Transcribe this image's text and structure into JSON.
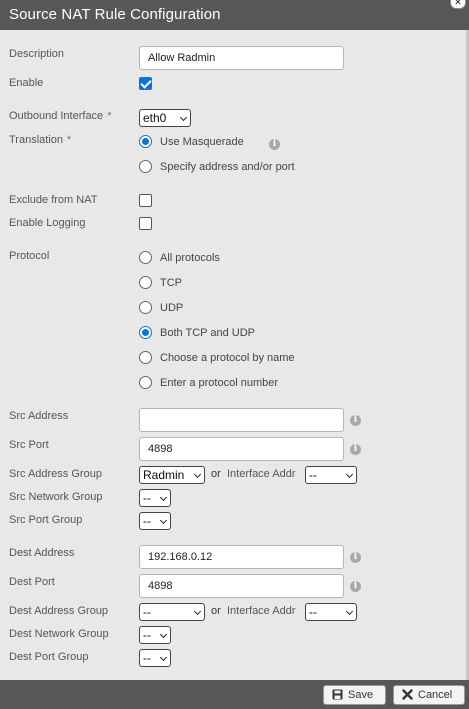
{
  "window": {
    "title": "Source NAT Rule Configuration",
    "close_icon": "close-icon"
  },
  "description": {
    "label": "Description",
    "value": "Allow Radmin"
  },
  "enable": {
    "label": "Enable",
    "checked": true
  },
  "outbound_interface": {
    "label": "Outbound Interface",
    "required_mark": "*",
    "value": "eth0"
  },
  "translation": {
    "label": "Translation",
    "required_mark": "*",
    "options": [
      "Use Masquerade",
      "Specify address and/or port"
    ],
    "selected": "Use Masquerade"
  },
  "exclude_from_nat": {
    "label": "Exclude from NAT",
    "checked": false
  },
  "enable_logging": {
    "label": "Enable Logging",
    "checked": false
  },
  "protocol": {
    "label": "Protocol",
    "options": [
      "All protocols",
      "TCP",
      "UDP",
      "Both TCP and UDP",
      "Choose a protocol by name",
      "Enter a protocol number"
    ],
    "selected": "Both TCP and UDP"
  },
  "src": {
    "address": {
      "label": "Src Address",
      "value": ""
    },
    "port": {
      "label": "Src Port",
      "value": "4898"
    },
    "address_group": {
      "label": "Src Address Group",
      "value": "Radmin",
      "or": "or",
      "interface_label": "Interface Addr",
      "interface_value": "--"
    },
    "network_group": {
      "label": "Src Network Group",
      "value": "--"
    },
    "port_group": {
      "label": "Src Port Group",
      "value": "--"
    }
  },
  "dest": {
    "address": {
      "label": "Dest Address",
      "value": "192.168.0.12"
    },
    "port": {
      "label": "Dest Port",
      "value": "4898"
    },
    "address_group": {
      "label": "Dest Address Group",
      "value": "--",
      "or": "or",
      "interface_label": "Interface Addr",
      "interface_value": "--"
    },
    "network_group": {
      "label": "Dest Network Group",
      "value": "--"
    },
    "port_group": {
      "label": "Dest Port Group",
      "value": "--"
    }
  },
  "footer": {
    "save_label": "Save",
    "cancel_label": "Cancel"
  },
  "info_glyph": "i",
  "colors": {
    "titlebar": "#575757",
    "accent": "#0a74da",
    "required": "#3d7fc2",
    "body": "#e8e8e8"
  }
}
